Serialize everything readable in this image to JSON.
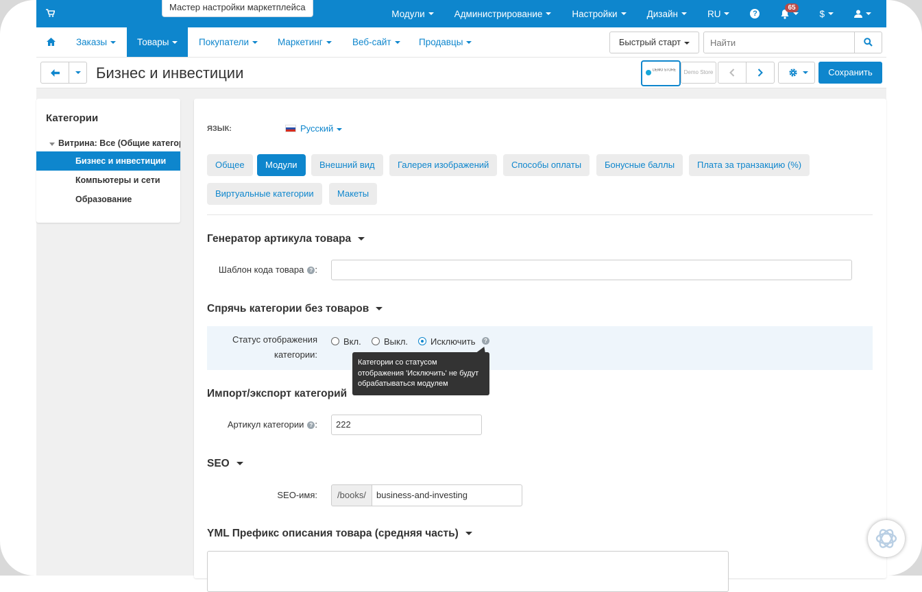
{
  "topbar": {
    "wizard_label": "Мастер настройки маркетплейса",
    "menus": [
      "Модули",
      "Администрирование",
      "Настройки",
      "Дизайн",
      "RU"
    ],
    "notifications_count": "65",
    "currency": "$"
  },
  "mainnav": {
    "items": [
      "Заказы",
      "Товары",
      "Покупатели",
      "Маркетинг",
      "Веб-сайт",
      "Продавцы"
    ],
    "active": "Товары",
    "quick_start": "Быстрый старт",
    "search_placeholder": "Найти"
  },
  "titlebar": {
    "title": "Бизнес и инвестиции",
    "store_label": "Demo Store",
    "save_label": "Сохранить"
  },
  "sidebar": {
    "title": "Категории",
    "root": "Витрина: Все (Общие категории)",
    "items": [
      "Бизнес и инвестиции",
      "Компьютеры и сети",
      "Образование"
    ],
    "active": "Бизнес и инвестиции"
  },
  "content": {
    "language_label": "Язык:",
    "language_value": "Русский",
    "tabs": [
      "Общее",
      "Модули",
      "Внешний вид",
      "Галерея изображений",
      "Способы оплаты",
      "Бонусные баллы",
      "Плата за транзакцию (%)",
      "Виртуальные категории",
      "Макеты"
    ],
    "active_tab": "Модули",
    "sections": {
      "sku_generator": {
        "heading": "Генератор артикула товара",
        "label": "Шаблон кода товара",
        "value": ""
      },
      "hide_empty": {
        "heading": "Спрячь категории без товаров",
        "label": "Статус отображения категории:",
        "options": [
          "Вкл.",
          "Выкл.",
          "Исключить"
        ],
        "selected": "Исключить",
        "tooltip": "Категории со статусом отображения 'Исключить' не будут обрабатываться модулем"
      },
      "import_export": {
        "heading": "Импорт/экспорт категорий",
        "label": "Артикул категории",
        "value": "222"
      },
      "seo": {
        "heading": "SEO",
        "label": "SEO-имя:",
        "prefix": "/books/",
        "value": "business-and-investing"
      },
      "yml": {
        "heading": "YML Префикс описания товара (средняя часть)"
      }
    }
  },
  "colors": {
    "accent": "#0e86cd",
    "tooltip_bg": "#333333",
    "highlight_row": "#eef5fb"
  }
}
